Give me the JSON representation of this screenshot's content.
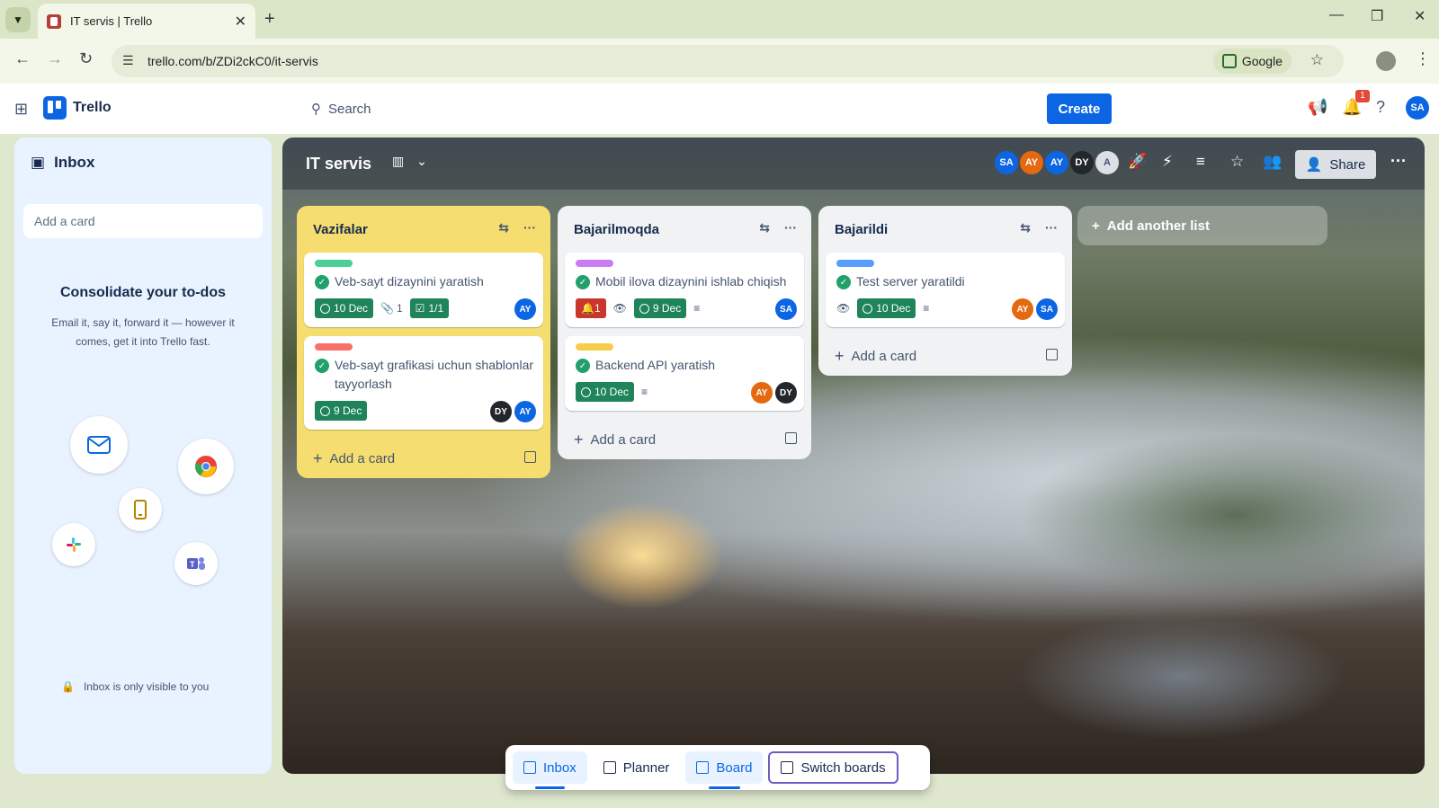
{
  "browser": {
    "tab_title": "IT servis | Trello",
    "url": "trello.com/b/ZDi2ckC0/it-servis",
    "google_label": "Google"
  },
  "header": {
    "app_name": "Trello",
    "search_placeholder": "Search",
    "create_label": "Create",
    "notification_count": "1",
    "user_initials": "SA"
  },
  "inbox": {
    "title": "Inbox",
    "add_card_placeholder": "Add a card",
    "heading": "Consolidate your to-dos",
    "description": "Email it, say it, forward it — however it comes, get it into Trello fast.",
    "footer": "Inbox is only visible to you"
  },
  "board": {
    "title": "IT servis",
    "members": [
      {
        "initials": "SA",
        "color": "#0c66e4"
      },
      {
        "initials": "AY",
        "color": "#e56910"
      },
      {
        "initials": "AY",
        "color": "#0c66e4"
      },
      {
        "initials": "DY",
        "color": "#22272b"
      },
      {
        "initials": "A",
        "color": "#dcdfe4"
      }
    ],
    "share_label": "Share",
    "add_list_label": "Add another list",
    "add_card_label": "Add a card",
    "lists": [
      {
        "title": "Vazifalar",
        "cards": [
          {
            "label_color": "#4bce97",
            "title": "Veb-sayt dizaynini yaratish",
            "date": "10 Dec",
            "attachments": "1",
            "checklist": "1/1",
            "members": [
              "AY"
            ]
          },
          {
            "label_color": "#f87168",
            "title": "Veb-sayt grafikasi uchun shablonlar tayyorlash",
            "date": "9 Dec",
            "members": [
              "DY",
              "AY"
            ]
          }
        ]
      },
      {
        "title": "Bajarilmoqda",
        "cards": [
          {
            "label_color": "#c97cf4",
            "title": "Mobil ilova dizaynini ishlab chiqish",
            "notifications": "1",
            "date": "9 Dec",
            "members": [
              "SA"
            ]
          },
          {
            "label_color": "#f5cd47",
            "title": "Backend API yaratish",
            "date": "10 Dec",
            "members": [
              "AY",
              "DY"
            ]
          }
        ]
      },
      {
        "title": "Bajarildi",
        "cards": [
          {
            "label_color": "#579dff",
            "title": "Test server yaratildi",
            "date": "10 Dec",
            "members": [
              "AY",
              "SA"
            ]
          }
        ]
      }
    ]
  },
  "bottom_nav": {
    "inbox": "Inbox",
    "planner": "Planner",
    "board": "Board",
    "switch_boards": "Switch boards"
  }
}
